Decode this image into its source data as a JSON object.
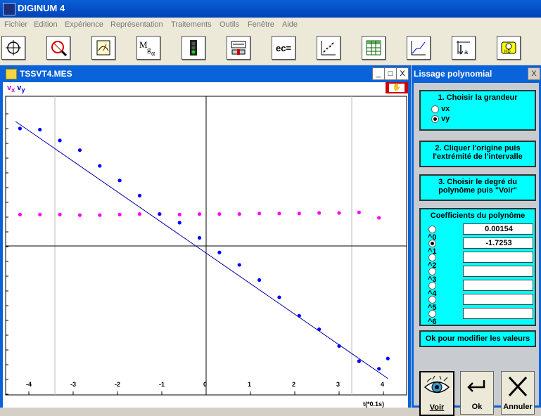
{
  "app": {
    "title": "DIGINUM 4"
  },
  "menu": [
    "Fichier",
    "Edition",
    "Expérience",
    "Représentation",
    "Traitements",
    "Outils",
    "Fenêtre",
    "Aide"
  ],
  "toolbar": {
    "labels": [
      "ec="
    ]
  },
  "graph_window": {
    "title": "TSSVT4.MES",
    "btn_min": "_",
    "btn_max": "□",
    "btn_close": "X",
    "legend_vx": "v",
    "legend_vx_sub": "x",
    "legend_vy": "v",
    "legend_vy_sub": "y",
    "axis_label": "t(*0.1s)"
  },
  "chart_data": {
    "type": "scatter",
    "x_ticks": [
      "-4",
      "-3",
      "-2",
      "-1",
      "0",
      "1",
      "2",
      "3",
      "4"
    ],
    "xlim": [
      -4.3,
      4.3
    ],
    "series": [
      {
        "name": "vx",
        "color": "#ff00ff",
        "x": [
          -4.2,
          -3.75,
          -3.3,
          -2.85,
          -2.4,
          -1.95,
          -1.5,
          -1.05,
          -0.6,
          -0.15,
          0.3,
          0.75,
          1.2,
          1.65,
          2.1,
          2.55,
          3.0,
          3.45,
          3.9
        ],
        "y": [
          0.58,
          0.58,
          0.58,
          0.57,
          0.57,
          0.58,
          0.59,
          0.59,
          0.58,
          0.59,
          0.59,
          0.59,
          0.6,
          0.6,
          0.6,
          0.61,
          0.61,
          0.62,
          0.52
        ]
      },
      {
        "name": "vy",
        "color": "#0000ff",
        "x": [
          -4.2,
          -3.75,
          -3.3,
          -2.85,
          -2.4,
          -1.95,
          -1.5,
          -1.05,
          -0.6,
          -0.15,
          0.3,
          0.75,
          1.2,
          1.65,
          2.1,
          2.55,
          3.0,
          3.45,
          3.9,
          4.1
        ],
        "y": [
          2.17,
          2.15,
          1.95,
          1.77,
          1.48,
          1.21,
          0.93,
          0.59,
          0.43,
          0.15,
          -0.12,
          -0.35,
          -0.63,
          -0.95,
          -1.29,
          -1.54,
          -1.85,
          -2.13,
          -2.27,
          -2.08
        ]
      },
      {
        "name": "fit",
        "color": "#0000aa",
        "x": [
          -4.3,
          4.1
        ],
        "y": [
          2.3,
          -2.45
        ]
      }
    ]
  },
  "panel": {
    "title": "Lissage polynomial",
    "close": "X",
    "step1": "1. Choisir la grandeur",
    "opt_vx": "vx",
    "opt_vy": "vy",
    "step2a": "2. Cliquer l'origine puis",
    "step2b": "l'extrémité de l'intervalle",
    "step3a": "3. Choisir le degré du",
    "step3b": "polynôme puis \"Voir\"",
    "coef_title": "Coefficients du polynôme",
    "coefs": [
      {
        "label": "^0",
        "value": "0.00154"
      },
      {
        "label": "^1",
        "value": "-1.7253"
      },
      {
        "label": "^2",
        "value": ""
      },
      {
        "label": "^3",
        "value": ""
      },
      {
        "label": "^4",
        "value": ""
      },
      {
        "label": "^5",
        "value": ""
      },
      {
        "label": "^6",
        "value": ""
      }
    ],
    "ok_modify": "Ok pour modifier les valeurs",
    "btn_voir": "Voir",
    "btn_ok": "Ok",
    "btn_annuler": "Annuler"
  }
}
